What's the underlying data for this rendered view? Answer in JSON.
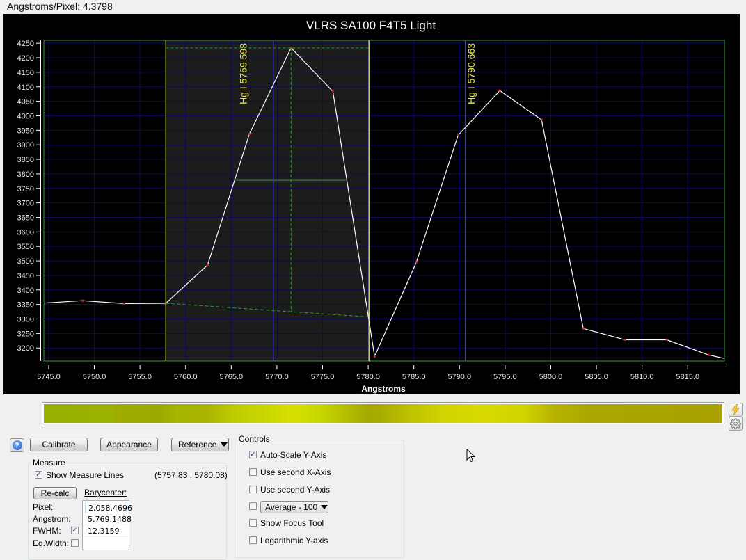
{
  "header": {
    "angstroms_per_pixel": "Angstroms/Pixel: 4.3798"
  },
  "chart_data": {
    "type": "line",
    "title": "VLRS SA100 F4T5 Light",
    "xlabel": "Angstroms",
    "ylabel": "",
    "xlim": [
      5744.47,
      5819.02
    ],
    "ylim": [
      3155,
      4260
    ],
    "grid": true,
    "xticks": [
      5745.0,
      5750.0,
      5755.0,
      5760.0,
      5765.0,
      5770.0,
      5775.0,
      5780.0,
      5785.0,
      5790.0,
      5795.0,
      5800.0,
      5805.0,
      5810.0,
      5815.0
    ],
    "xtick_labels": [
      "5745.0",
      "5750.0",
      "5755.0",
      "5760.0",
      "5765.0",
      "5770.0",
      "5775.0",
      "5780.0",
      "5785.0",
      "5790.0",
      "5795.0",
      "5800.0",
      "5805.0",
      "5810.0",
      "5815.0"
    ],
    "yticks": [
      3200,
      3250,
      3300,
      3350,
      3400,
      3450,
      3500,
      3550,
      3600,
      3650,
      3700,
      3750,
      3800,
      3850,
      3900,
      3950,
      4000,
      4050,
      4100,
      4150,
      4200,
      4250
    ],
    "ytick_labels": [
      "3200",
      "3250",
      "3300",
      "3350",
      "3400",
      "3450",
      "3500",
      "3550",
      "3600",
      "3650",
      "3700",
      "3750",
      "3800",
      "3850",
      "3900",
      "3950",
      "4000",
      "4050",
      "4100",
      "4150",
      "4200",
      "4250"
    ],
    "series": [
      {
        "name": "spectrum",
        "x": [
          5744.12,
          5748.69,
          5753.26,
          5757.83,
          5762.41,
          5766.98,
          5771.55,
          5776.13,
          5780.7,
          5785.27,
          5789.85,
          5794.42,
          5798.99,
          5803.56,
          5808.14,
          5812.71,
          5817.28,
          5821.85
        ],
        "y": [
          3354,
          3363,
          3353,
          3354,
          3486,
          3937,
          4234,
          4084,
          3171,
          3495,
          3933,
          4087,
          3986,
          3267,
          3228,
          3228,
          3176,
          3144
        ]
      }
    ],
    "measure": {
      "start": 5757.83,
      "end": 5780.08,
      "peak": {
        "x": 5771.55,
        "y": 4234
      },
      "baseline": [
        [
          5757.83,
          3354
        ],
        [
          5780.08,
          3307
        ]
      ],
      "fwhm": {
        "y": 3778,
        "x1": 5765.38,
        "x2": 5777.65
      }
    },
    "reference_lines": [
      {
        "label": "Hg I 5769.598",
        "x": 5769.598
      },
      {
        "label": "Hg I 5790.663",
        "x": 5790.663
      }
    ],
    "colors": {
      "background": "#000000",
      "measure_region": "#1c1c1c",
      "grid": "#0b0b5c",
      "frame": "#2f7f2f",
      "line": "#ffffff",
      "markers": "#e02020",
      "measure_lines": "#ffff99",
      "measure_guides": "#2e9a2e",
      "reference_lines": "#8a8aff",
      "reference_labels": "#e6e640",
      "text": "#e8e8e8"
    }
  },
  "side_buttons": {
    "top_icon": "lightning-icon",
    "bottom_icon": "gear-icon"
  },
  "toolbar": {
    "help": "?",
    "calibrate": "Calibrate",
    "appearance": "Appearance",
    "reference": "Reference"
  },
  "measure": {
    "group_title": "Measure",
    "show_lines_label": "Show Measure Lines",
    "show_lines_checked": true,
    "range": "(5757.83 ; 5780.08)",
    "recalc": "Re-calc",
    "barycenter_label": "Barycenter:",
    "rows": [
      {
        "label": "Pixel:",
        "value": "2,058.4696"
      },
      {
        "label": "Angstrom:",
        "value": "5,769.1488"
      },
      {
        "label": "FWHM:",
        "value": "12.3159",
        "checked": true
      },
      {
        "label": "Eq.Width:",
        "value": "",
        "checked": false
      }
    ]
  },
  "controls": {
    "group_title": "Controls",
    "items": [
      {
        "label": "Auto-Scale Y-Axis",
        "checked": true
      },
      {
        "label": "Use second X-Axis",
        "checked": false
      },
      {
        "label": "Use second Y-Axis",
        "checked": false
      },
      {
        "label": "",
        "checked": false,
        "select": "Average - 100"
      },
      {
        "label": "Show Focus Tool",
        "checked": false
      },
      {
        "label": "Logarithmic Y-axis",
        "checked": false
      }
    ]
  }
}
